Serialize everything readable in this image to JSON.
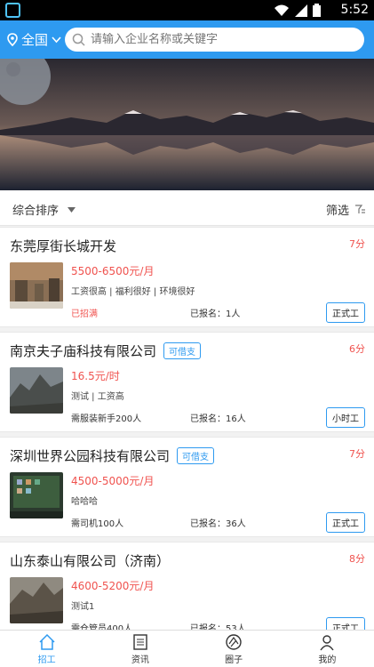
{
  "status": {
    "time": "5:52"
  },
  "header": {
    "location": "全国",
    "search_placeholder": "请输入企业名称或关键字"
  },
  "sortbar": {
    "sort_label": "综合排序",
    "filter_label": "筛选"
  },
  "jobs": [
    {
      "company": "东莞厚街长城开发",
      "badge": "",
      "time": "7分",
      "salary": "5500-6500元/月",
      "tags": "工资很高 | 福利很好 | 环境很好",
      "requirement": "已招满",
      "signed": "已报名：1人",
      "type": "正式工"
    },
    {
      "company": "南京夫子庙科技有限公司",
      "badge": "可借支",
      "time": "6分",
      "salary": "16.5元/时",
      "tags": "测试 | 工资高",
      "requirement": "需服装新手200人",
      "signed": "已报名：16人",
      "type": "小时工"
    },
    {
      "company": "深圳世界公园科技有限公司",
      "badge": "可借支",
      "time": "7分",
      "salary": "4500-5000元/月",
      "tags": "哈哈哈",
      "requirement": "需司机100人",
      "signed": "已报名：36人",
      "type": "正式工"
    },
    {
      "company": "山东泰山有限公司（济南）",
      "badge": "",
      "time": "8分",
      "salary": "4600-5200元/月",
      "tags": "测试1",
      "requirement": "需仓管员400人",
      "signed": "已报名：53人",
      "type": "正式工"
    }
  ],
  "nav": [
    {
      "label": "招工",
      "icon": "home-icon",
      "active": true
    },
    {
      "label": "资讯",
      "icon": "news-icon",
      "active": false
    },
    {
      "label": "圈子",
      "icon": "circle-icon",
      "active": false
    },
    {
      "label": "我的",
      "icon": "profile-icon",
      "active": false
    }
  ],
  "colors": {
    "primary": "#2e9af0",
    "accent_red": "#f0534f"
  }
}
